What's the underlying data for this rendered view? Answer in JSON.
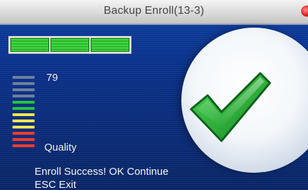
{
  "window": {
    "title": "Backup Enroll(13-3)"
  },
  "enroll_progress": {
    "completed_segments": 3,
    "total_segments": 3
  },
  "quality": {
    "score": "79",
    "label": "Quality",
    "bar_colors": [
      "#6f7f9f",
      "#6f7f9f",
      "#6f7f9f",
      "#6f7f9f",
      "#27c23d",
      "#27c23d",
      "#f5e84a",
      "#f5e84a",
      "#f5e84a",
      "#ff3b2e",
      "#ff3b2e",
      "#ff3b2e"
    ]
  },
  "status": {
    "message": "Enroll Success! OK Continue",
    "exit_hint": "ESC Exit"
  },
  "icons": {
    "success": "checkmark-icon",
    "close": "close-icon"
  }
}
